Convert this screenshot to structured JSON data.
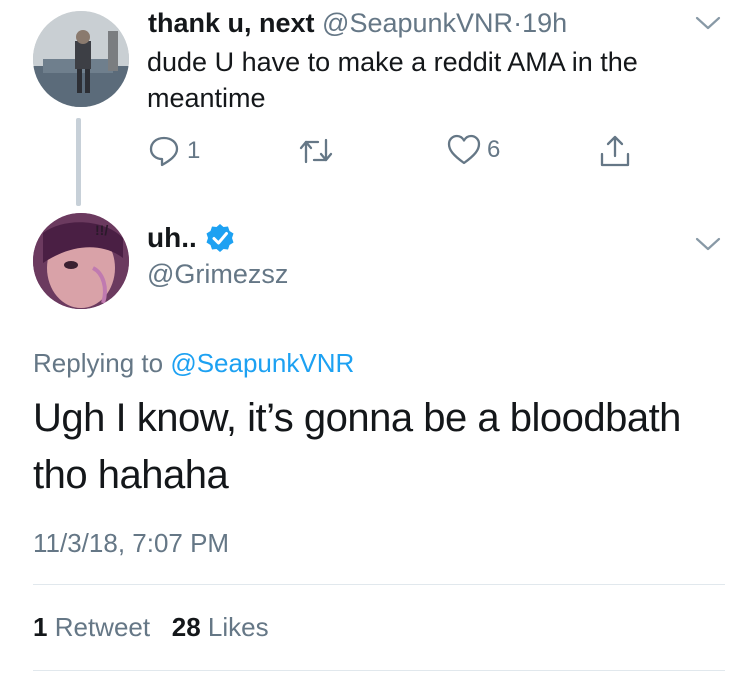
{
  "parent_tweet": {
    "display_name": "thank u, next",
    "handle": "@SeapunkVNR",
    "separator": "·",
    "time_ago": "19h",
    "text": "dude U have to make a reddit AMA in the meantime",
    "reply_count": "1",
    "like_count": "6",
    "icons": [
      "reply-icon",
      "retweet-icon",
      "like-icon",
      "share-icon",
      "chevron-down-icon"
    ]
  },
  "main_tweet": {
    "display_name": "uh..",
    "verified": true,
    "handle": "@Grimezsz",
    "replying_prefix": "Replying to",
    "replying_handle": "@SeapunkVNR",
    "text": "Ugh I know, it’s gonna be a bloodbath tho hahaha",
    "timestamp": "11/3/18, 7:07 PM",
    "retweets_count": "1",
    "retweets_label": "Retweet",
    "likes_count": "28",
    "likes_label": "Likes"
  },
  "colors": {
    "text": "#14171a",
    "muted": "#657786",
    "link": "#1da1f2",
    "verified": "#1da1f2",
    "divider": "#e1e8ed",
    "thread_line": "#c7d0d8"
  }
}
